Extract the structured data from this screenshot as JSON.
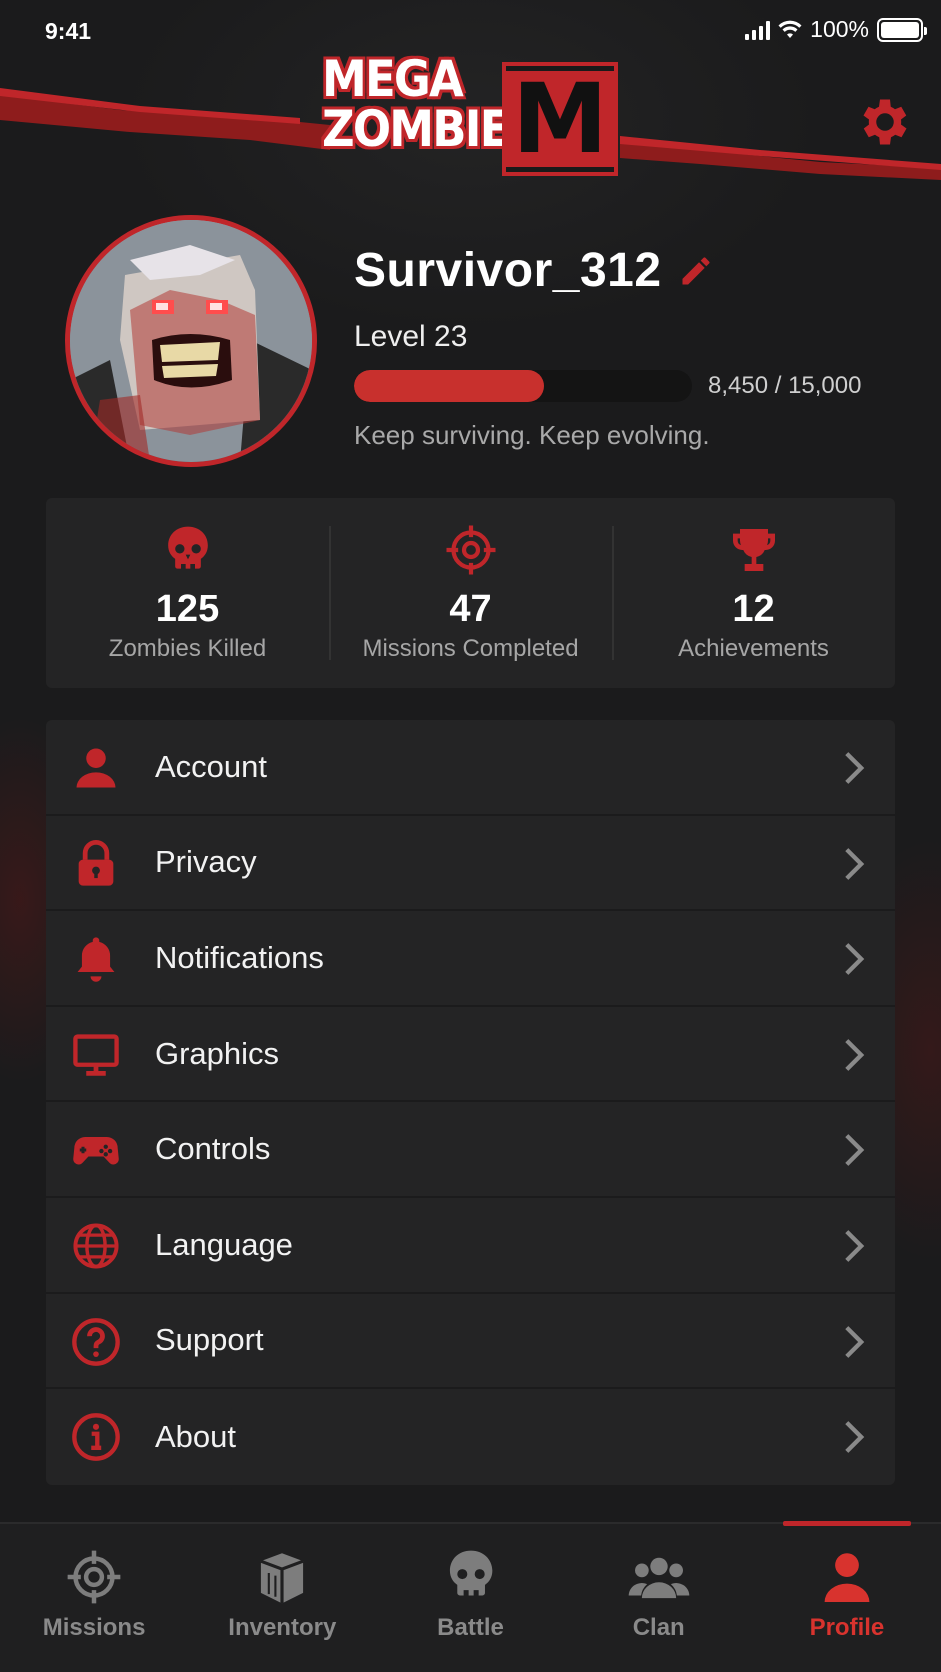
{
  "status_bar": {
    "time": "9:41",
    "battery": "100%"
  },
  "header": {
    "logo_line1": "MEGA",
    "logo_line2": "ZOMBIE",
    "logo_letter": "M",
    "settings_icon": "gear-icon"
  },
  "profile": {
    "username": "Survivor_312",
    "level": "Level 23",
    "xp_text": "8,450 / 15,000",
    "xp_fraction": 0.563,
    "tagline": "Keep surviving. Keep evolving."
  },
  "stats": [
    {
      "icon": "skull-icon",
      "value": "125",
      "label": "Zombies Killed"
    },
    {
      "icon": "crosshair-icon",
      "value": "47",
      "label": "Missions Completed"
    },
    {
      "icon": "trophy-icon",
      "value": "12",
      "label": "Achievements"
    }
  ],
  "menu": [
    {
      "icon": "user-icon",
      "label": "Account"
    },
    {
      "icon": "lock-icon",
      "label": "Privacy"
    },
    {
      "icon": "bell-icon",
      "label": "Notifications"
    },
    {
      "icon": "monitor-icon",
      "label": "Graphics"
    },
    {
      "icon": "gamepad-icon",
      "label": "Controls"
    },
    {
      "icon": "globe-icon",
      "label": "Language"
    },
    {
      "icon": "question-icon",
      "label": "Support"
    },
    {
      "icon": "info-icon",
      "label": "About"
    }
  ],
  "bottom_nav": [
    {
      "icon": "crosshair-icon",
      "label": "Missions",
      "active": false
    },
    {
      "icon": "crate-icon",
      "label": "Inventory",
      "active": false
    },
    {
      "icon": "skull-icon",
      "label": "Battle",
      "active": false
    },
    {
      "icon": "group-icon",
      "label": "Clan",
      "active": false
    },
    {
      "icon": "user-icon",
      "label": "Profile",
      "active": true
    }
  ],
  "colors": {
    "accent": "#c0262a",
    "background": "#1b1b1c",
    "card": "#242425",
    "muted": "#8a8a8a"
  }
}
